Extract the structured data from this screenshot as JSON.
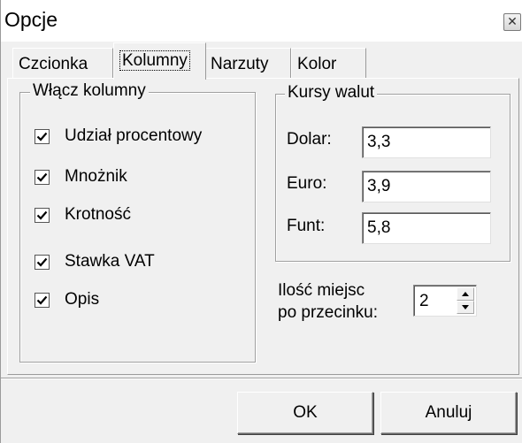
{
  "window": {
    "title": "Opcje"
  },
  "icons": {
    "close": "close-icon",
    "check": "checkmark-icon",
    "spin_up": "arrow-up-icon",
    "spin_down": "arrow-down-icon"
  },
  "tabs": [
    {
      "label": "Czcionka",
      "active": false
    },
    {
      "label": "Kolumny",
      "active": true
    },
    {
      "label": "Narzuty",
      "active": false
    },
    {
      "label": "Kolor",
      "active": false
    }
  ],
  "columns_group": {
    "title": "Włącz kolumny",
    "items": [
      {
        "label": "Udział procentowy",
        "checked": true
      },
      {
        "label": "Mnożnik",
        "checked": true
      },
      {
        "label": "Krotność",
        "checked": true
      },
      {
        "label": "Stawka VAT",
        "checked": true
      },
      {
        "label": "Opis",
        "checked": true
      }
    ]
  },
  "rates_group": {
    "title": "Kursy walut",
    "rows": [
      {
        "label": "Dolar:",
        "value": "3,3"
      },
      {
        "label": "Euro:",
        "value": "3,9"
      },
      {
        "label": "Funt:",
        "value": "5,8"
      }
    ]
  },
  "decimals": {
    "label_line1": "Ilość miejsc",
    "label_line2": "po przecinku:",
    "value": "2"
  },
  "buttons": {
    "ok": "OK",
    "cancel": "Anuluj"
  }
}
